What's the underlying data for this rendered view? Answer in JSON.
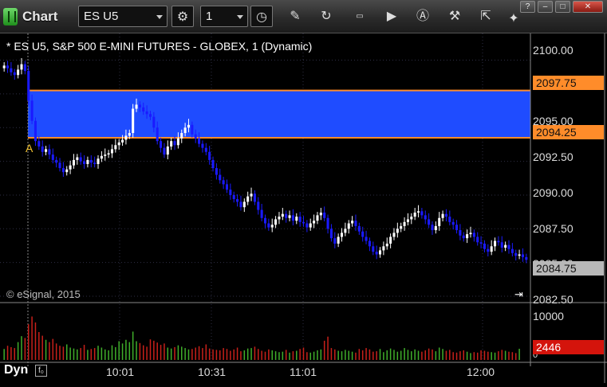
{
  "window": {
    "title": "Chart",
    "symbol": "ES U5",
    "interval": "1",
    "toolbar_icons": [
      "settings-icon",
      "clock-icon",
      "pencil-icon",
      "refresh-icon",
      "edit-icon",
      "play-icon",
      "alert-icon",
      "tools-icon",
      "cursor-icon",
      "tweet-icon"
    ],
    "window_controls": [
      "?",
      "–",
      "□",
      "✕"
    ]
  },
  "chart": {
    "title": "* ES U5, S&P 500 E-MINI FUTURES - GLOBEX, 1 (Dynamic)",
    "copyright": "© eSignal, 2015",
    "marker_label": "A",
    "price_axis": [
      "2100.00",
      "2097.50",
      "2095.00",
      "2092.50",
      "2090.00",
      "2087.50",
      "2085.00",
      "2082.50"
    ],
    "zone_top": "2097.75",
    "zone_bottom": "2094.25",
    "last_price": "2084.75",
    "volume_axis": [
      "10000",
      "0"
    ],
    "last_volume": "2446",
    "time_axis": [
      "10:01",
      "10:31",
      "11:01",
      "12:00"
    ],
    "dyn_label": "Dyn",
    "colors": {
      "zone": "#1f4cff",
      "zone_line": "#ff8c2a",
      "up": "#ffffff",
      "down": "#1a1aff",
      "vol_up": "#3fae2a",
      "vol_down": "#c8201a",
      "grid": "#2e2e44"
    }
  },
  "chart_data": {
    "type": "candlestick",
    "ylim": [
      2082.5,
      2100.8
    ],
    "closes": [
      2099.6,
      2099.4,
      2099.1,
      2098.9,
      2099.3,
      2099.7,
      2099.2,
      2097.0,
      2095.5,
      2094.0,
      2093.6,
      2093.2,
      2093.4,
      2093.0,
      2092.6,
      2092.4,
      2092.0,
      2091.7,
      2091.9,
      2092.2,
      2092.6,
      2092.8,
      2092.5,
      2092.3,
      2092.6,
      2092.4,
      2092.3,
      2092.7,
      2092.9,
      2093.0,
      2093.1,
      2093.4,
      2093.7,
      2093.9,
      2094.1,
      2094.4,
      2094.6,
      2096.4,
      2096.7,
      2096.5,
      2096.2,
      2096.0,
      2095.8,
      2095.0,
      2094.0,
      2093.5,
      2093.0,
      2093.6,
      2094.0,
      2093.7,
      2094.2,
      2094.6,
      2095.0,
      2095.2,
      2094.5,
      2094.2,
      2093.8,
      2093.5,
      2093.2,
      2092.6,
      2092.0,
      2091.5,
      2091.1,
      2090.8,
      2090.4,
      2090.0,
      2089.7,
      2089.5,
      2089.1,
      2089.5,
      2089.9,
      2090.1,
      2089.5,
      2088.9,
      2088.3,
      2087.9,
      2087.6,
      2087.8,
      2088.2,
      2088.4,
      2088.6,
      2088.3,
      2088.5,
      2088.1,
      2088.4,
      2088.0,
      2087.9,
      2087.6,
      2087.9,
      2088.1,
      2088.5,
      2088.7,
      2088.3,
      2087.5,
      2086.8,
      2086.4,
      2086.9,
      2087.2,
      2087.5,
      2087.9,
      2088.1,
      2087.7,
      2087.3,
      2086.9,
      2086.6,
      2086.2,
      2085.8,
      2085.6,
      2085.9,
      2086.2,
      2086.4,
      2086.9,
      2087.2,
      2087.5,
      2087.7,
      2088.0,
      2088.2,
      2088.4,
      2088.7,
      2088.8,
      2088.5,
      2088.2,
      2087.8,
      2087.4,
      2087.7,
      2088.3,
      2088.6,
      2088.4,
      2088.0,
      2087.8,
      2087.4,
      2087.0,
      2086.8,
      2087.1,
      2087.2,
      2086.9,
      2086.5,
      2086.4,
      2086.0,
      2085.8,
      2086.2,
      2086.6,
      2086.5,
      2086.1,
      2086.3,
      2086.0,
      2085.7,
      2085.5,
      2085.6,
      2085.4,
      2085.2
    ],
    "volumes": [
      2400,
      3100,
      2800,
      2600,
      3900,
      5200,
      4800,
      7800,
      9500,
      8200,
      6100,
      5300,
      4400,
      3900,
      4600,
      3600,
      3100,
      2900,
      3400,
      2700,
      2500,
      2300,
      2600,
      3300,
      2200,
      2400,
      2600,
      3100,
      2700,
      2300,
      2100,
      3200,
      2800,
      4100,
      3600,
      4400,
      3900,
      6200,
      4100,
      3700,
      3200,
      2900,
      4500,
      4200,
      3800,
      3300,
      3600,
      2700,
      2500,
      2800,
      3200,
      2900,
      2600,
      2300,
      2400,
      2700,
      3000,
      2600,
      3400,
      2500,
      2300,
      2200,
      2100,
      2600,
      2400,
      2000,
      2300,
      2700,
      1900,
      2100,
      2500,
      2600,
      2900,
      2400,
      2000,
      1800,
      2300,
      2100,
      1900,
      1700,
      1800,
      2200,
      1600,
      1900,
      2000,
      2400,
      2700,
      1700,
      1600,
      1800,
      2100,
      2300,
      4200,
      5100,
      2600,
      2300,
      2000,
      1900,
      2200,
      2000,
      1800,
      1600,
      2400,
      2100,
      2600,
      2300,
      1800,
      1900,
      2400,
      1700,
      2100,
      2500,
      2200,
      1800,
      2000,
      2600,
      2200,
      1900,
      2300,
      2000,
      1800,
      2100,
      2500,
      2300,
      1900,
      2700,
      2400,
      2000,
      2200,
      1700,
      1600,
      1900,
      2100,
      1800,
      1500,
      1700,
      1600,
      2100,
      2000,
      1800,
      1700,
      1600,
      1900,
      2200,
      2000,
      1800,
      1700,
      1500,
      2446
    ]
  }
}
